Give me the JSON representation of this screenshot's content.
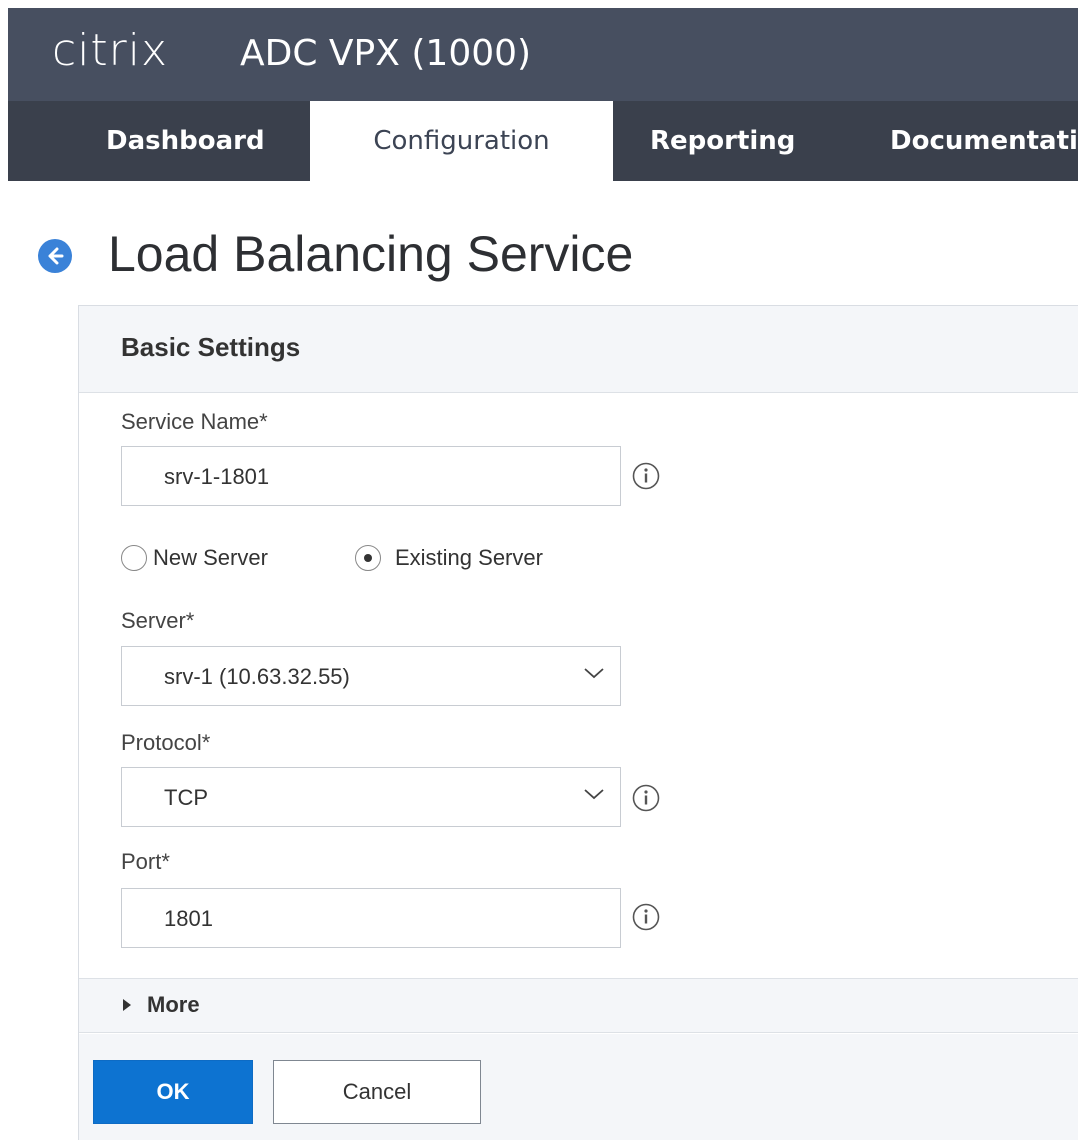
{
  "header": {
    "logo_text": "citrix",
    "product_title": "ADC VPX (1000)"
  },
  "nav": {
    "tabs": [
      {
        "label": "Dashboard",
        "active": false
      },
      {
        "label": "Configuration",
        "active": true
      },
      {
        "label": "Reporting",
        "active": false
      },
      {
        "label": "Documentati",
        "active": false
      }
    ]
  },
  "page": {
    "title": "Load Balancing Service"
  },
  "panel": {
    "header": "Basic Settings",
    "service_name": {
      "label": "Service Name*",
      "value": "srv-1-1801"
    },
    "server_type": {
      "options": [
        {
          "label": "New Server",
          "selected": false
        },
        {
          "label": "Existing Server",
          "selected": true
        }
      ]
    },
    "server": {
      "label": "Server*",
      "value": "srv-1 (10.63.32.55)"
    },
    "protocol": {
      "label": "Protocol*",
      "value": "TCP"
    },
    "port": {
      "label": "Port*",
      "value": "1801"
    },
    "more_label": "More"
  },
  "buttons": {
    "ok": "OK",
    "cancel": "Cancel"
  },
  "colors": {
    "header_bg": "#474f60",
    "nav_bg": "#3a404c",
    "primary_button": "#0d73d1",
    "back_icon": "#3a82d8"
  },
  "icons": [
    "back-arrow-icon",
    "info-icon",
    "chevron-down-icon",
    "caret-right-icon"
  ]
}
